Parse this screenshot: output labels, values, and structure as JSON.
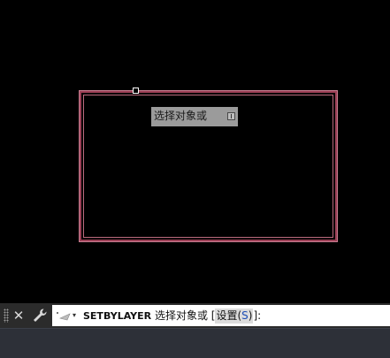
{
  "tooltip": {
    "text": "选择对象或",
    "icon": "down-arrow-icon"
  },
  "command_line": {
    "close_icon": "close-icon",
    "customize_icon": "wrench-icon",
    "prompt_icon": "command-prompt-icon",
    "prompt_arrow": "▾",
    "command_name": "SETBYLAYER",
    "prompt": "选择对象或",
    "bracket_open": "[",
    "option_label": "设置",
    "option_paren_open": "(",
    "option_key": "S",
    "option_paren_close": ")",
    "bracket_close": "]:",
    "close_symbol": "✕"
  },
  "colors": {
    "rectangle": "#9b3f55",
    "background": "#000000",
    "tooltip_bg": "#9b9b9b",
    "option_key": "#1e4fb6"
  }
}
